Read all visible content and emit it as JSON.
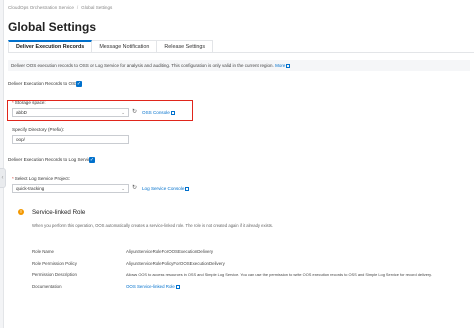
{
  "breadcrumb": [
    "CloudOps Orchestration Service",
    "Global Settings"
  ],
  "page_title": "Global Settings",
  "tabs": [
    {
      "label": "Deliver Execution Records",
      "active": true
    },
    {
      "label": "Message Notification",
      "active": false
    },
    {
      "label": "Release Settings",
      "active": false
    }
  ],
  "banner": {
    "text": "Deliver OOS execution records to OSS or Log Service for analysis and auditing. This configuration is only valid in the current region.",
    "link": "More"
  },
  "oss": {
    "checkbox_label": "Deliver Execution Records to OSS:",
    "checked": true,
    "storage_label": "Storage space:",
    "storage_value": "abbD",
    "console_link": "OSS Console",
    "directory_label": "Specify Directory (Prefix):",
    "directory_value": "oop/"
  },
  "sls": {
    "checkbox_label": "Deliver Execution Records to Log Service:",
    "checked": true,
    "project_label": "Select Log Service Project:",
    "project_value": "quick-tracking",
    "console_link": "Log Service Console"
  },
  "role": {
    "title": "Service-linked Role",
    "description": "When you perform this operation, OOS automatically creates a service-linked role. The role is not created again if it already exists.",
    "rows": [
      {
        "key": "Role Name",
        "value": "AliyunServiceRoleForOOSExecutionDelivery"
      },
      {
        "key": "Role Permission Policy",
        "value": "AliyunServiceRolePolicyForOOSExecutionDelivery"
      },
      {
        "key": "Permission Description",
        "value": "Allows OOS to access resources in OSS and Simple Log Service. You can use the permission to write OOS execution records to OSS and Simple Log Service for record delivery."
      },
      {
        "key": "Documentation",
        "value": "OOS Service-linked Role"
      }
    ]
  },
  "colors": {
    "accent": "#0070cc",
    "highlight": "#e0261c",
    "warning": "#f39800"
  }
}
